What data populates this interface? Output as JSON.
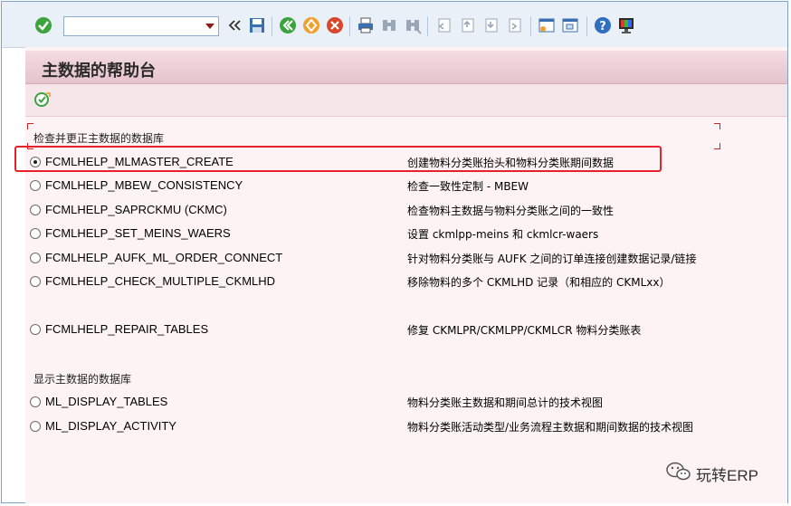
{
  "toolbar": {
    "command_field_value": "",
    "icons": [
      "enter-icon",
      "history-back-icon",
      "save-icon",
      "back-icon",
      "exit-icon",
      "cancel-icon",
      "print-icon",
      "find-icon",
      "find-next-icon",
      "first-page-icon",
      "previous-page-icon",
      "next-page-icon",
      "last-page-icon",
      "create-session-icon",
      "shortcut-icon",
      "help-icon",
      "customize-layout-icon"
    ]
  },
  "screen": {
    "title": "主数据的帮助台"
  },
  "groups": [
    {
      "title": "检查并更正主数据的数据库",
      "options": [
        {
          "label": "FCMLHELP_MLMASTER_CREATE",
          "desc": "创建物料分类账抬头和物料分类账期间数据",
          "selected": true
        },
        {
          "label": "FCMLHELP_MBEW_CONSISTENCY",
          "desc": "检查一致性定制 - MBEW",
          "selected": false
        },
        {
          "label": "FCMLHELP_SAPRCKMU (CKMC)",
          "desc": "检查物料主数据与物料分类账之间的一致性",
          "selected": false
        },
        {
          "label": "FCMLHELP_SET_MEINS_WAERS",
          "desc": "设置 ckmlpp-meins 和 ckmlcr-waers",
          "selected": false
        },
        {
          "label": "FCMLHELP_AUFK_ML_ORDER_CONNECT",
          "desc": "针对物料分类账与 AUFK 之间的订单连接创建数据记录/链接",
          "selected": false
        },
        {
          "label": "FCMLHELP_CHECK_MULTIPLE_CKMLHD",
          "desc": "移除物料的多个 CKMLHD 记录（和相应的 CKMLxx）",
          "selected": false
        },
        {
          "label": "FCMLHELP_REPAIR_TABLES",
          "desc": "修复 CKMLPR/CKMLPP/CKMLCR 物料分类账表",
          "selected": false
        }
      ]
    },
    {
      "title": "显示主数据的数据库",
      "options": [
        {
          "label": "ML_DISPLAY_TABLES",
          "desc": "物料分类账主数据和期间总计的技术视图",
          "selected": false
        },
        {
          "label": "ML_DISPLAY_ACTIVITY",
          "desc": "物料分类账活动类型/业务流程主数据和期间数据的技术视图",
          "selected": false
        }
      ]
    }
  ],
  "watermark": {
    "text": "玩转ERP"
  },
  "colors": {
    "highlight_border": "#e8202a",
    "title_bar": "#e6c3cc",
    "content_bg": "#fdf3f5",
    "toolbar_bg": "#eaf0f7"
  }
}
